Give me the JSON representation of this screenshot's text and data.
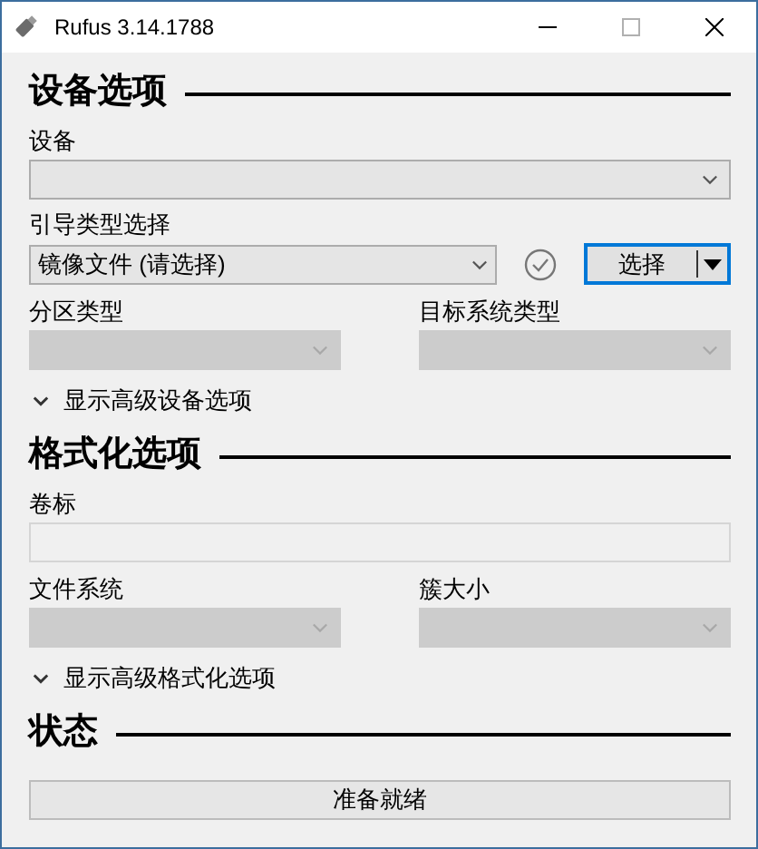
{
  "window": {
    "title": "Rufus 3.14.1788"
  },
  "sections": [
    {
      "heading": "设备选项",
      "rows": [
        [
          {
            "kind": "combo",
            "label": "设备",
            "disabled": false
          }
        ],
        [
          {
            "kind": "boot",
            "label": "引导类型选择",
            "value": "镜像文件 (请选择)",
            "button": "选择"
          }
        ],
        [
          {
            "kind": "combo",
            "label": "分区类型",
            "disabled": true
          },
          {
            "kind": "combo",
            "label": "目标系统类型",
            "disabled": true
          }
        ],
        [
          {
            "kind": "toggle",
            "label": "显示高级设备选项",
            "expanded": false
          }
        ]
      ]
    },
    {
      "heading": "格式化选项",
      "rows": [
        [
          {
            "kind": "text_field",
            "label": "卷标"
          }
        ],
        [
          {
            "kind": "combo",
            "label": "文件系统",
            "disabled": true
          },
          {
            "kind": "combo",
            "label": "簇大小",
            "disabled": true
          }
        ],
        [
          {
            "kind": "toggle",
            "label": "显示高级格式化选项",
            "expanded": false
          }
        ]
      ]
    },
    {
      "heading": "状态",
      "rows": [
        [
          {
            "kind": "status",
            "text": "准备就绪"
          }
        ]
      ]
    }
  ]
}
